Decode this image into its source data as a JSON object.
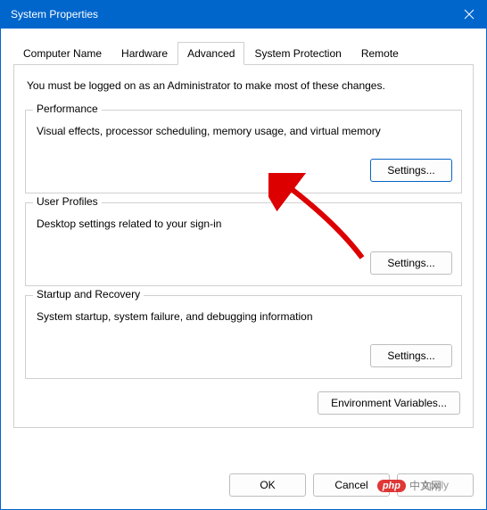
{
  "title": "System Properties",
  "tabs": {
    "computer_name": "Computer Name",
    "hardware": "Hardware",
    "advanced": "Advanced",
    "system_protection": "System Protection",
    "remote": "Remote"
  },
  "intro": "You must be logged on as an Administrator to make most of these changes.",
  "groups": {
    "performance": {
      "title": "Performance",
      "desc": "Visual effects, processor scheduling, memory usage, and virtual memory",
      "button": "Settings..."
    },
    "user_profiles": {
      "title": "User Profiles",
      "desc": "Desktop settings related to your sign-in",
      "button": "Settings..."
    },
    "startup": {
      "title": "Startup and Recovery",
      "desc": "System startup, system failure, and debugging information",
      "button": "Settings..."
    }
  },
  "env_button": "Environment Variables...",
  "bottom": {
    "ok": "OK",
    "cancel": "Cancel",
    "apply": "Apply"
  },
  "watermark": {
    "logo": "php",
    "text": "中文网"
  }
}
